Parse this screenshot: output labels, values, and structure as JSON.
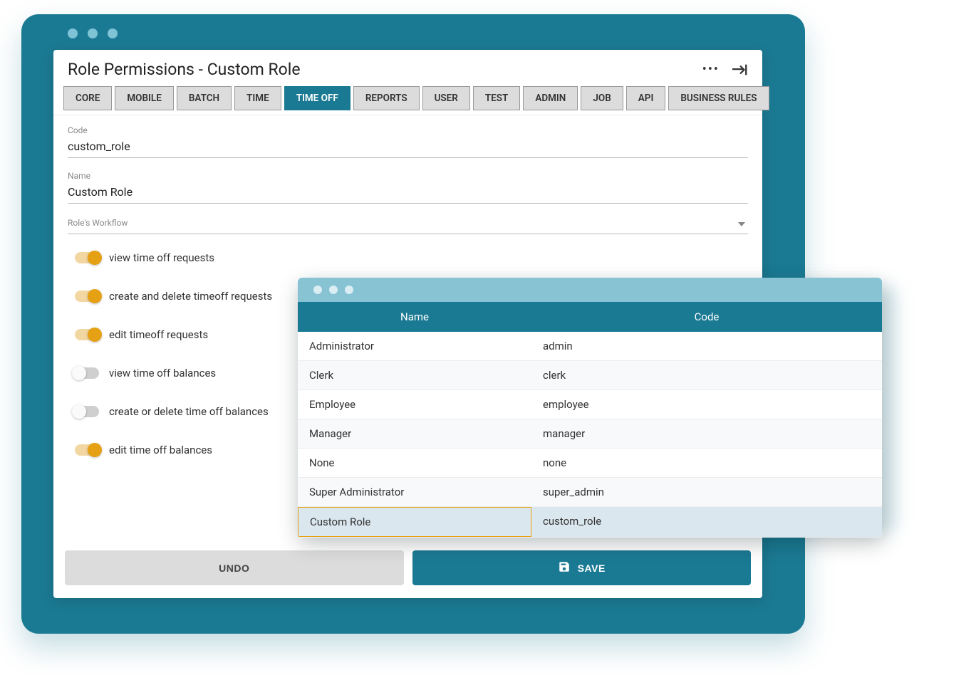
{
  "colors": {
    "primary": "#1b7a93",
    "accent": "#e6a014"
  },
  "header": {
    "title": "Role Permissions - Custom Role"
  },
  "tabs": [
    {
      "label": "CORE",
      "active": false
    },
    {
      "label": "MOBILE",
      "active": false
    },
    {
      "label": "BATCH",
      "active": false
    },
    {
      "label": "TIME",
      "active": false
    },
    {
      "label": "TIME OFF",
      "active": true
    },
    {
      "label": "REPORTS",
      "active": false
    },
    {
      "label": "USER",
      "active": false
    },
    {
      "label": "TEST",
      "active": false
    },
    {
      "label": "ADMIN",
      "active": false
    },
    {
      "label": "JOB",
      "active": false
    },
    {
      "label": "API",
      "active": false
    },
    {
      "label": "BUSINESS RULES",
      "active": false
    }
  ],
  "fields": {
    "code": {
      "label": "Code",
      "value": "custom_role"
    },
    "name": {
      "label": "Name",
      "value": "Custom Role"
    },
    "workflow": {
      "label": "Role's Workflow",
      "value": ""
    }
  },
  "permissions": [
    {
      "label": "view time off requests",
      "on": true
    },
    {
      "label": "create and delete timeoff requests",
      "on": true
    },
    {
      "label": "edit timeoff requests",
      "on": true
    },
    {
      "label": "view time off balances",
      "on": false
    },
    {
      "label": "create or delete time off balances",
      "on": false
    },
    {
      "label": "edit time off balances",
      "on": true
    }
  ],
  "actions": {
    "undo": "UNDO",
    "save": "SAVE"
  },
  "dataPanel": {
    "columns": {
      "name": "Name",
      "code": "Code"
    },
    "rows": [
      {
        "name": "Administrator",
        "code": "admin",
        "selected": false
      },
      {
        "name": "Clerk",
        "code": "clerk",
        "selected": false
      },
      {
        "name": "Employee",
        "code": "employee",
        "selected": false
      },
      {
        "name": "Manager",
        "code": "manager",
        "selected": false
      },
      {
        "name": "None",
        "code": "none",
        "selected": false
      },
      {
        "name": "Super Administrator",
        "code": "super_admin",
        "selected": false
      },
      {
        "name": "Custom Role",
        "code": "custom_role",
        "selected": true
      }
    ]
  }
}
